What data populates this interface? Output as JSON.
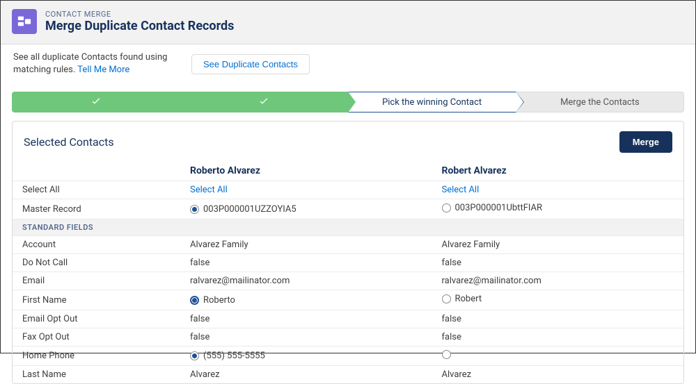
{
  "header": {
    "eyebrow": "CONTACT MERGE",
    "title": "Merge Duplicate Contact Records"
  },
  "helper": {
    "text_prefix": "See all duplicate Contacts found using matching rules. ",
    "tell_me_more": "Tell Me More",
    "button": "See Duplicate Contacts"
  },
  "progress": {
    "step3": "Pick the winning Contact",
    "step4": "Merge the Contacts"
  },
  "panel": {
    "title": "Selected Contacts",
    "merge_button": "Merge"
  },
  "table": {
    "col_a_header": "Roberto Alvarez",
    "col_b_header": "Robert Alvarez",
    "select_all_label": "Select All",
    "select_all_link": "Select All",
    "section_standard": "STANDARD FIELDS",
    "rows": {
      "master_record": {
        "label": "Master Record",
        "a": "003P000001UZZOYIA5",
        "b": "003P000001UbttFIAR"
      },
      "account": {
        "label": "Account",
        "a": "Alvarez Family",
        "b": "Alvarez Family"
      },
      "do_not_call": {
        "label": "Do Not Call",
        "a": "false",
        "b": "false"
      },
      "email": {
        "label": "Email",
        "a": "ralvarez@mailinator.com",
        "b": "ralvarez@mailinator.com"
      },
      "first_name": {
        "label": "First Name",
        "a": "Roberto",
        "b": "Robert"
      },
      "email_opt_out": {
        "label": "Email Opt Out",
        "a": "false",
        "b": "false"
      },
      "fax_opt_out": {
        "label": "Fax Opt Out",
        "a": "false",
        "b": "false"
      },
      "home_phone": {
        "label": "Home Phone",
        "a": "(555) 555-5555",
        "b": ""
      },
      "last_name": {
        "label": "Last Name",
        "a": "Alvarez",
        "b": "Alvarez"
      }
    }
  }
}
